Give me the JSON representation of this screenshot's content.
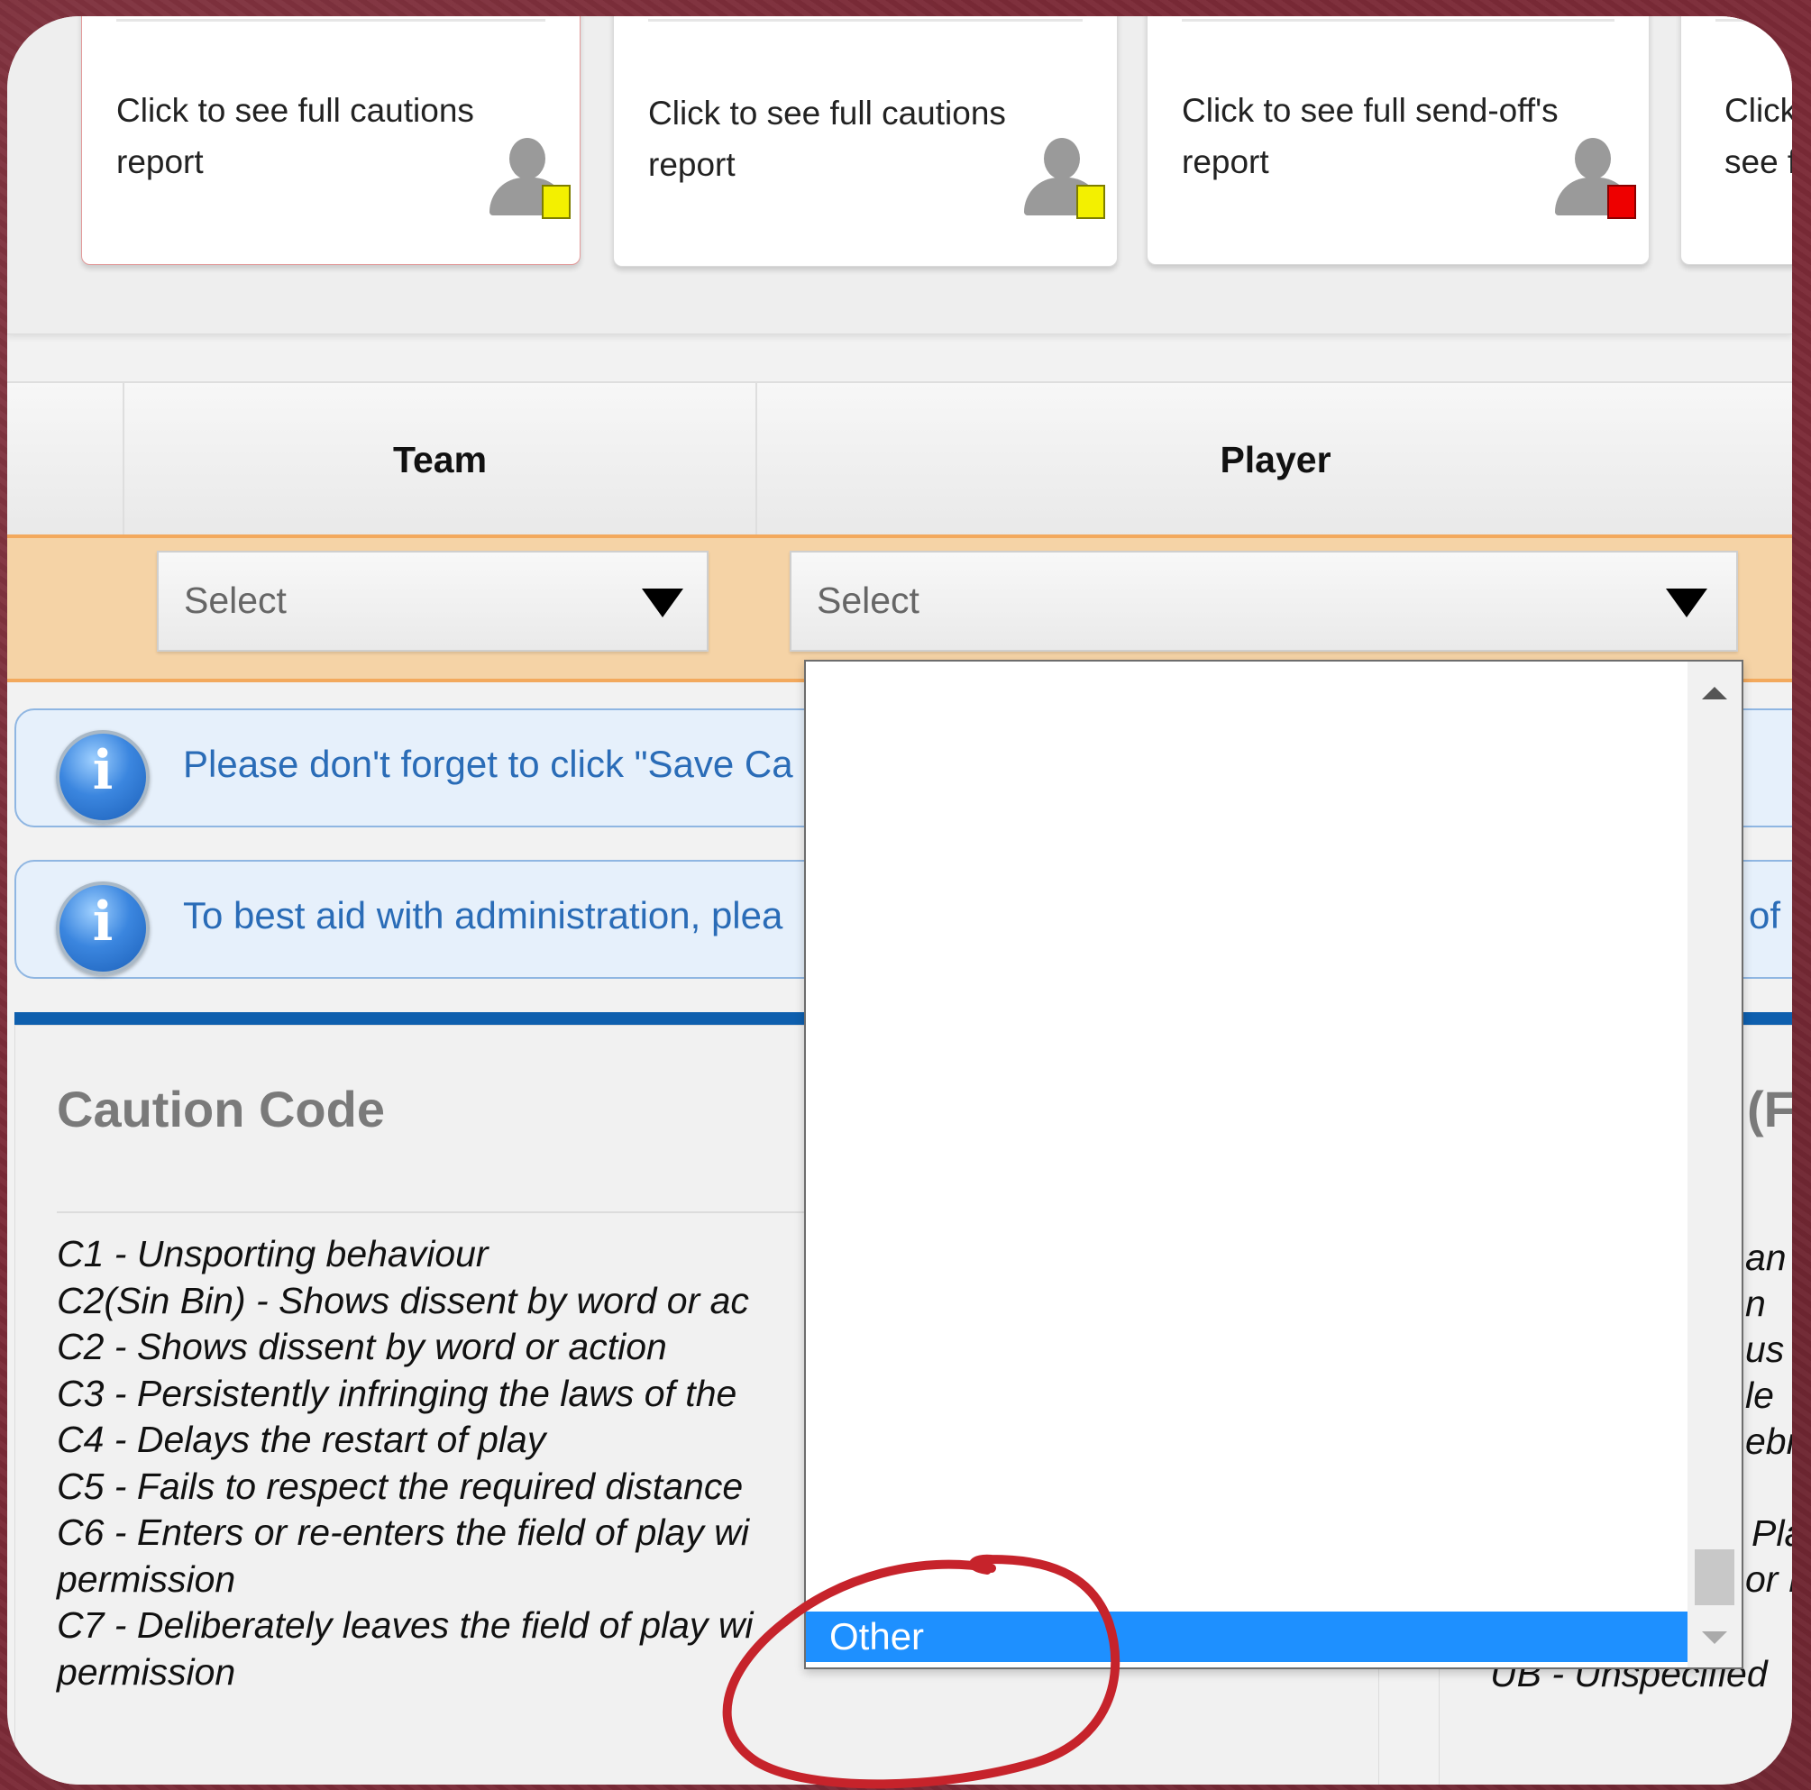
{
  "cards": [
    {
      "text": "Click to see full cautions report",
      "icon": "yellow-card-player-icon"
    },
    {
      "text": "Click to see full cautions report",
      "icon": "yellow-card-player-icon"
    },
    {
      "text": "Click to see full send-off's report",
      "icon": "red-card-player-icon"
    },
    {
      "text": "Click to see full",
      "icon": ""
    }
  ],
  "table": {
    "team_header": "Team",
    "player_header": "Player",
    "team_select": "Select",
    "player_select": "Select"
  },
  "info": {
    "msg1": "Please don't forget to click \"Save Ca",
    "msg2": "To best aid with administration, plea",
    "msg2_tail": "of"
  },
  "caution": {
    "title": "Caution Code",
    "codes": [
      "C1 - Unsporting behaviour",
      "C2(Sin Bin) - Shows dissent by word or ac",
      "C2 - Shows dissent by word or action",
      "C3 - Persistently infringing the laws of the",
      "C4 - Delays the restart of play",
      "C5 - Fails to respect the required distance",
      "C6 - Enters or re-enters the field of play wi",
      "permission",
      "C7 - Deliberately leaves the field of play wi",
      "permission"
    ]
  },
  "sendoff": {
    "title_fragment": "(F",
    "fragments": [
      "an",
      "n",
      "us F",
      "le",
      "ebr",
      "",
      "Pla",
      "or F"
    ],
    "ub_code": "UB - Unspecified"
  },
  "dropdown": {
    "selected_option": "Other"
  },
  "colors": {
    "accent_orange": "#f3a95d",
    "highlight_blue": "#1e90ff",
    "annotation_red": "#c6232b"
  }
}
